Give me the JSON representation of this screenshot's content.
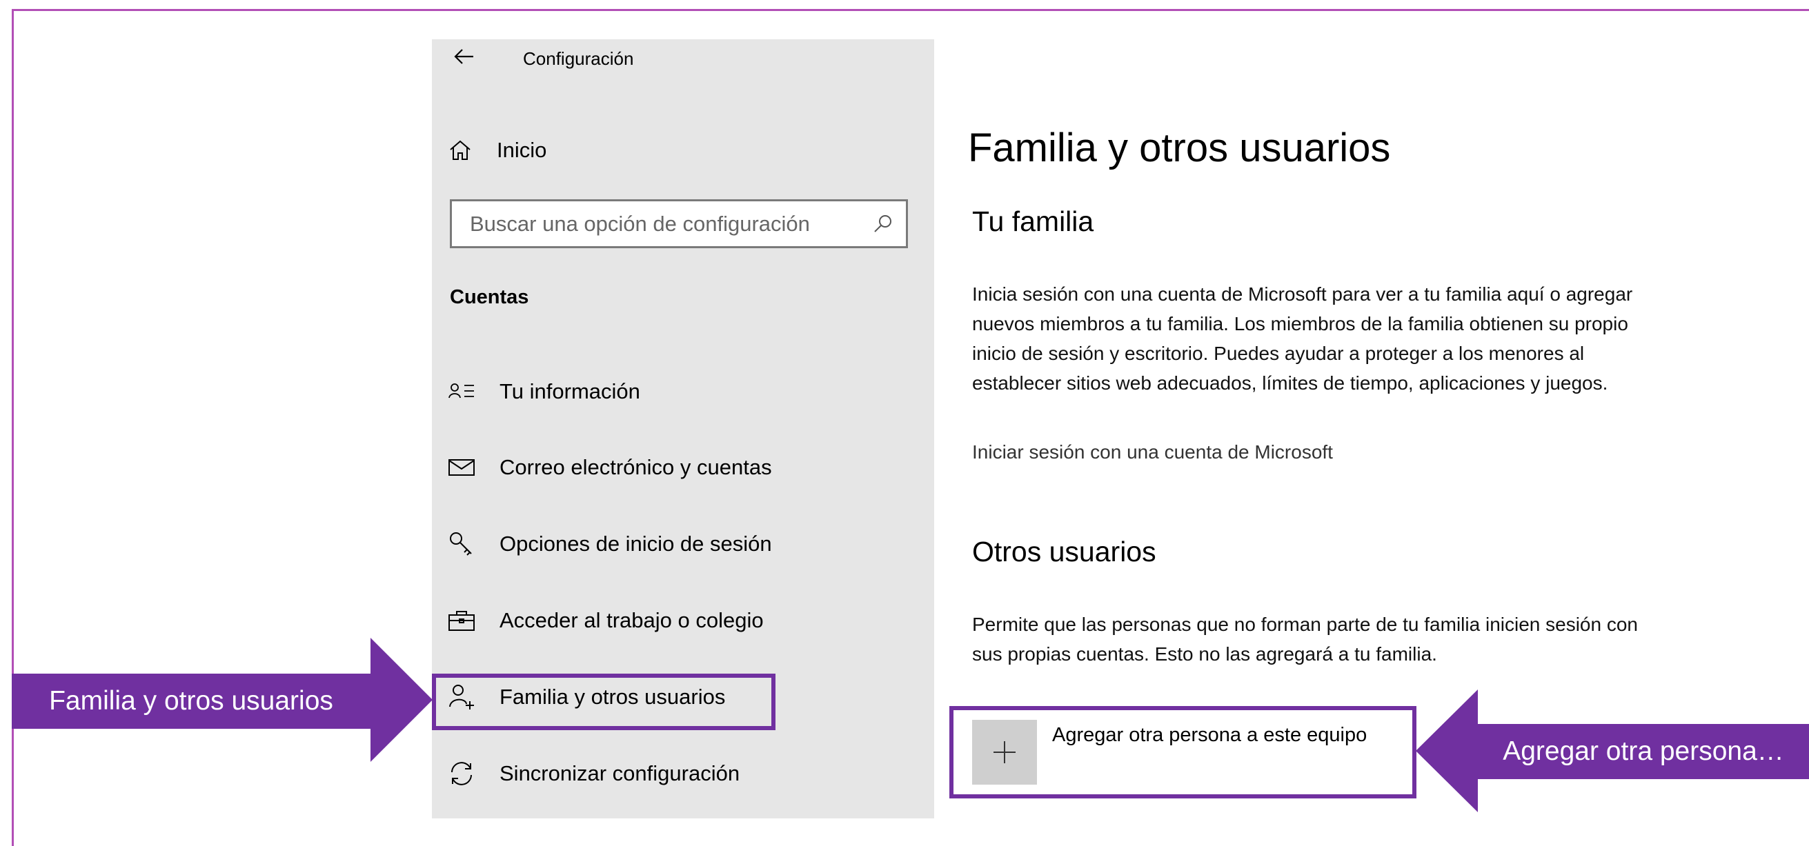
{
  "window": {
    "app_title": "Configuración",
    "back_icon": "back-arrow-icon"
  },
  "sidebar": {
    "home_label": "Inicio",
    "search_placeholder": "Buscar una opción de configuración",
    "section_label": "Cuentas",
    "items": [
      {
        "label": "Tu información",
        "icon": "user-info-icon"
      },
      {
        "label": "Correo electrónico y cuentas",
        "icon": "mail-icon"
      },
      {
        "label": "Opciones de inicio de sesión",
        "icon": "key-icon"
      },
      {
        "label": "Acceder al trabajo o colegio",
        "icon": "briefcase-icon"
      },
      {
        "label": "Familia y otros usuarios",
        "icon": "add-person-icon",
        "selected": true
      },
      {
        "label": "Sincronizar configuración",
        "icon": "sync-icon"
      }
    ]
  },
  "main": {
    "title": "Familia y otros usuarios",
    "family_heading": "Tu familia",
    "family_text": "Inicia sesión con una cuenta de Microsoft para ver a tu familia aquí o agregar nuevos miembros a tu familia. Los miembros de la familia obtienen su propio inicio de sesión y escritorio. Puedes ayudar a proteger a los menores al establecer sitios web adecuados, límites de tiempo, aplicaciones y juegos.",
    "family_link": "Iniciar sesión con una cuenta de Microsoft",
    "others_heading": "Otros usuarios",
    "others_text": "Permite que las personas que no forman parte de tu familia inicien sesión con sus propias cuentas. Esto no las agregará a tu familia.",
    "add_button_label": "Agregar otra persona a este equipo"
  },
  "callouts": {
    "left": "Familia y otros usuarios",
    "right": "Agregar otra persona…"
  },
  "colors": {
    "accent": "#7030a0",
    "frame": "#b24fb6",
    "sidebar_bg": "#e6e6e6"
  }
}
